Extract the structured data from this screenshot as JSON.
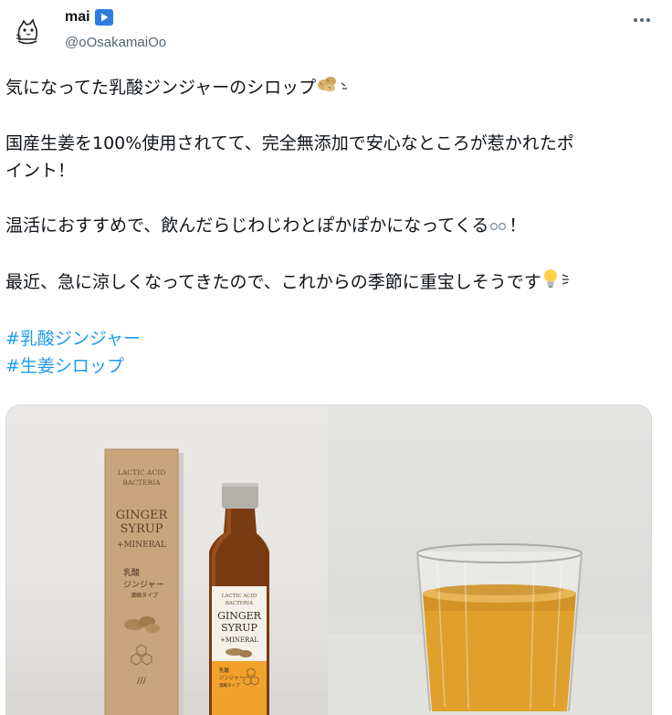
{
  "user": {
    "display_name": "mai",
    "handle": "@oOsakamaiOo"
  },
  "icons": {
    "badge": "play-button-icon",
    "more": "more-options-icon",
    "ginger_emoji": "ginger-root-emoji",
    "lightbulb_emoji": "lightbulb-emoji",
    "sparkle_emoji": "sparkle-emoji",
    "droplet_emoji": "droplet-emoji"
  },
  "tweet": {
    "line1": "気になってた乳酸ジンジャーのシロップ",
    "line2a": "国産生姜を100%使用されてて、完全無添加で安心なところが惹かれたポ",
    "line2b": "イント！",
    "line3_text": "温活におすすめで、飲んだらじわじわとぽかぽかになってくる",
    "line3_end": "！",
    "line4": "最近、急に涼しくなってきたので、これからの季節に重宝しそうです",
    "hashtag1": "#乳酸ジンジャー",
    "hashtag2": "#生姜シロップ"
  },
  "product_box": {
    "line1": "LACTIC ACID",
    "line2": "BACTERIA",
    "title1": "GINGER",
    "title2": "SYRUP",
    "title3": "+MINERAL",
    "jp1": "乳酸",
    "jp2": "ジンジャー",
    "jp3": "濃縮タイプ"
  },
  "bottle_label": {
    "line1": "LACTIC ACID",
    "line2": "BACTERIA",
    "title1": "GINGER",
    "title2": "SYRUP",
    "title3": "+MINERAL",
    "jp1": "乳酸",
    "jp2": "ジンジャー",
    "jp3": "濃縮タイプ"
  },
  "colors": {
    "text": "#0f1419",
    "secondary": "#536471",
    "link": "#1d9bf0",
    "badge": "#2d7de0",
    "box": "#c9a57e",
    "syrup": "#e0a12c"
  }
}
